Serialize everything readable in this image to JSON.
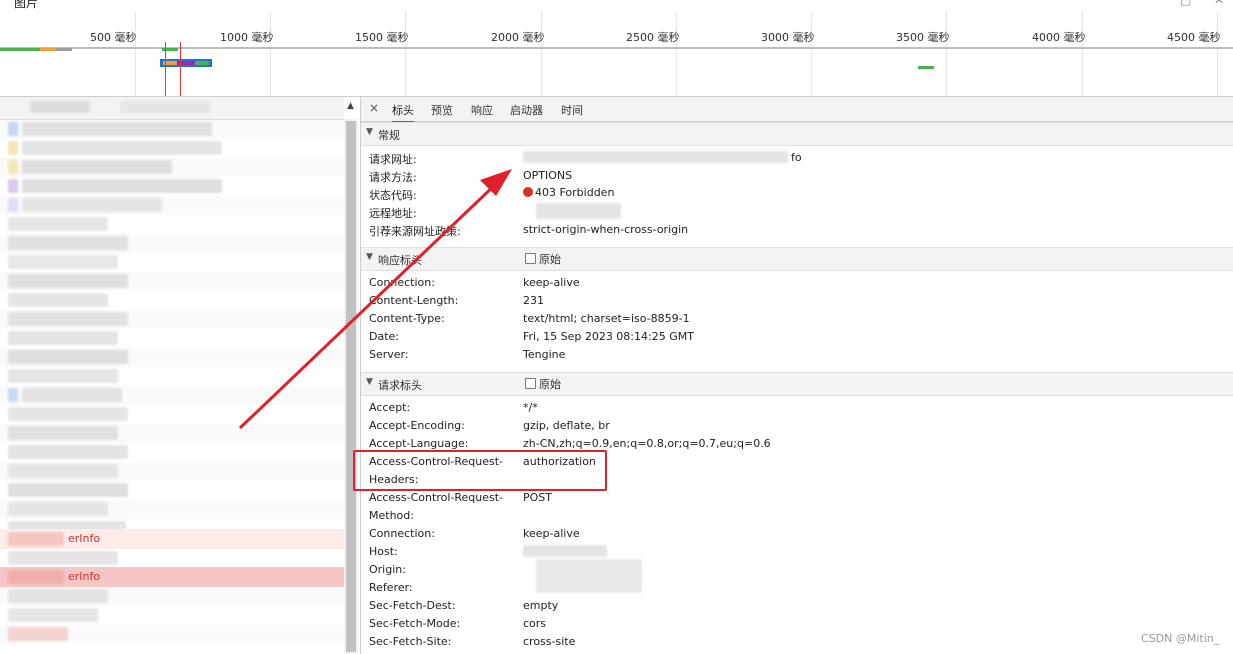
{
  "window": {
    "title": "图片",
    "controls": [
      "□",
      "✕"
    ]
  },
  "timeline": {
    "ticks": [
      "500 毫秒",
      "1000 毫秒",
      "1500 毫秒",
      "2000 毫秒",
      "2500 毫秒",
      "3000 毫秒",
      "3500 毫秒",
      "4000 毫秒",
      "4500 毫秒"
    ]
  },
  "request_list": {
    "visible_names": [
      "erInfo",
      "erInfo"
    ],
    "selected_index": 1
  },
  "detail_tabs": {
    "close_label": "×",
    "tabs": [
      "标头",
      "预览",
      "响应",
      "启动器",
      "时间"
    ],
    "active": "标头"
  },
  "general": {
    "title": "常规",
    "rows": [
      {
        "name": "请求网址:",
        "value": "fo"
      },
      {
        "name": "请求方法:",
        "value": "OPTIONS"
      },
      {
        "name": "状态代码:",
        "value": "403 Forbidden"
      },
      {
        "name": "远程地址:",
        "value": ""
      },
      {
        "name": "引荐来源网址政策:",
        "value": "strict-origin-when-cross-origin"
      }
    ]
  },
  "response_headers": {
    "title": "响应标头",
    "raw_label": "原始",
    "rows": [
      {
        "name": "Connection:",
        "value": "keep-alive"
      },
      {
        "name": "Content-Length:",
        "value": "231"
      },
      {
        "name": "Content-Type:",
        "value": "text/html; charset=iso-8859-1"
      },
      {
        "name": "Date:",
        "value": "Fri, 15 Sep 2023 08:14:25 GMT"
      },
      {
        "name": "Server:",
        "value": "Tengine"
      }
    ]
  },
  "request_headers": {
    "title": "请求标头",
    "raw_label": "原始",
    "rows": [
      {
        "name": "Accept:",
        "value": "*/*"
      },
      {
        "name": "Accept-Encoding:",
        "value": "gzip, deflate, br"
      },
      {
        "name": "Accept-Language:",
        "value": "zh-CN,zh;q=0.9,en;q=0.8,or;q=0.7,eu;q=0.6"
      },
      {
        "name": "Access-Control-Request-",
        "name2": "Headers:",
        "value": "authorization"
      },
      {
        "name": "Access-Control-Request-",
        "name2": "Method:",
        "value": "POST"
      },
      {
        "name": "Connection:",
        "value": "keep-alive"
      },
      {
        "name": "Host:",
        "value": ""
      },
      {
        "name": "Origin:",
        "value": ""
      },
      {
        "name": "Referer:",
        "value": ""
      },
      {
        "name": "Sec-Fetch-Dest:",
        "value": "empty"
      },
      {
        "name": "Sec-Fetch-Mode:",
        "value": "cors"
      },
      {
        "name": "Sec-Fetch-Site:",
        "value": "cross-site"
      }
    ]
  },
  "watermark": "CSDN @Mitin_",
  "colors": {
    "accent": "#1a73e8",
    "error": "#d93025",
    "annotation": "#e0202a"
  }
}
